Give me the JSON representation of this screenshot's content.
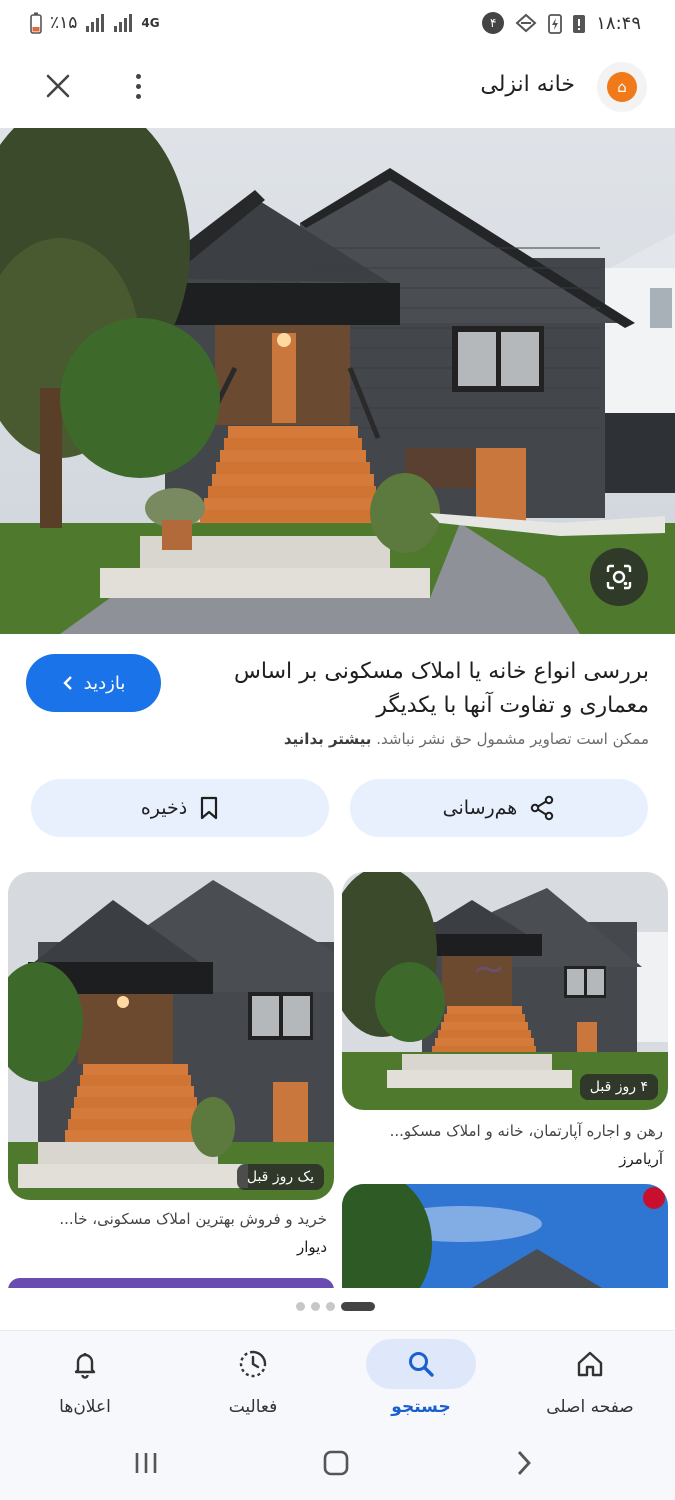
{
  "status_bar": {
    "battery": "٪۱۵",
    "network": "4G",
    "notification_count": "۴",
    "time": "۱۸:۴۹"
  },
  "header": {
    "site_name": "خانه انزلی",
    "logo_glyph": "⌂"
  },
  "result": {
    "title": "بررسی انواع خانه یا املاک مسکونی بر اساس معماری و تفاوت آنها با یکدیگر",
    "copyright_notice": "ممکن است تصاویر مشمول حق نشر نباشد.",
    "learn_more": "بیشتر بدانید",
    "visit_label": "بازدید",
    "share_label": "هم‌رسانی",
    "save_label": "ذخیره"
  },
  "related": [
    {
      "time": "یک روز قبل",
      "title": "خرید و فروش بهترین املاک مسکونی، خا...",
      "source": "دیوار"
    },
    {
      "time": "۴ روز قبل",
      "title": "رهن و اجاره آپارتمان، خانه و املاک مسکو...",
      "source": "آریامرز"
    }
  ],
  "pager": {
    "pages": 4,
    "active": 4
  },
  "bottom_nav": [
    {
      "label": "صفحه اصلی",
      "icon": "home-icon"
    },
    {
      "label": "جستجو",
      "icon": "search-icon",
      "active": true
    },
    {
      "label": "فعالیت",
      "icon": "activity-icon"
    },
    {
      "label": "اعلان‌ها",
      "icon": "bell-icon"
    }
  ],
  "colors": {
    "accent": "#1a73e8",
    "chip_bg": "#e8f0fe",
    "logo": "#f07a1a"
  }
}
